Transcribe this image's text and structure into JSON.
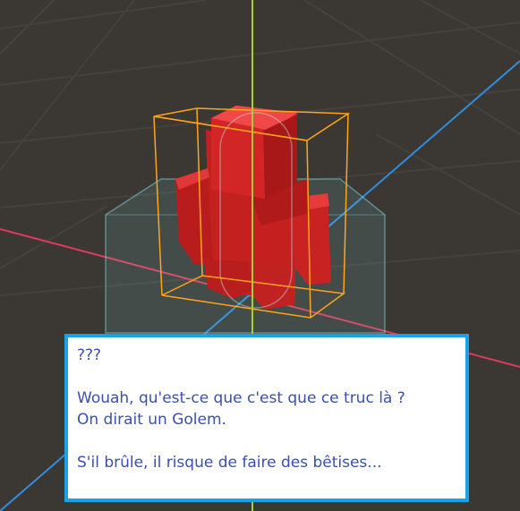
{
  "colors": {
    "background": "#3b3733",
    "grid_line": "#46413c",
    "y_axis": "#a4d234",
    "z_axis": "#2f8de0",
    "x_axis": "#dc3c5a",
    "golem": "#d62a2a",
    "selection_box": "#ffa51c",
    "collider": "#8ce6f0",
    "dialog_border": "#1ca0e6",
    "dialog_text": "#3a4fb0"
  },
  "dialog": {
    "speaker": "???",
    "line1": "Wouah, qu'est-ce que c'est que ce truc là ?",
    "line2": "On dirait un Golem.",
    "line3": "S'il brûle, il risque de faire des bêtises..."
  }
}
